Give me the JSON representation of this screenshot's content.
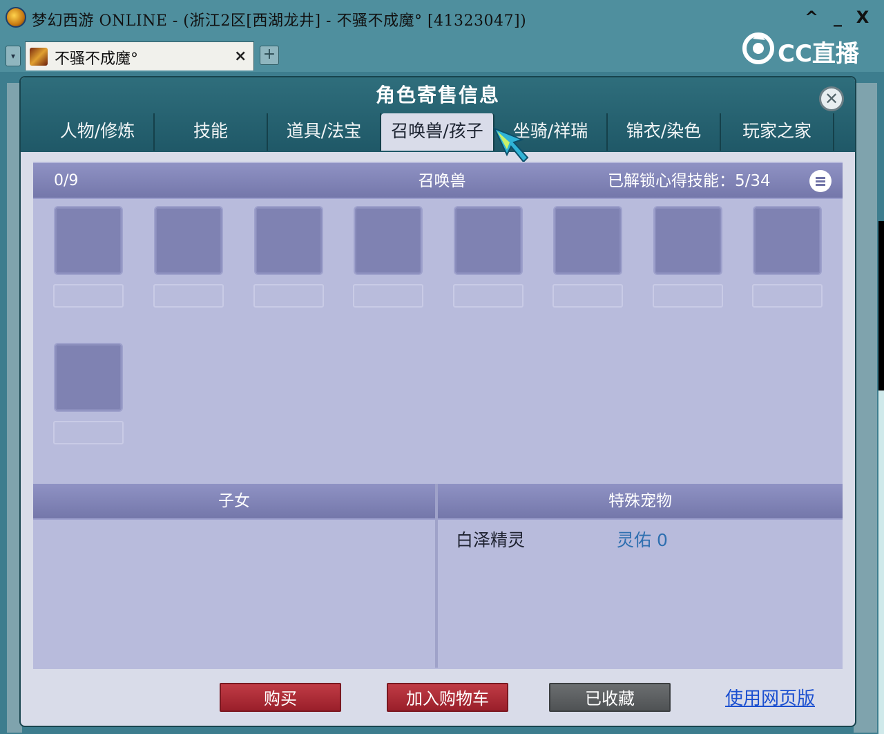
{
  "window": {
    "title": "梦幻西游 ONLINE - (浙江2区[西湖龙井] - 不骚不成魔° [41323047])",
    "controls": [
      "^",
      "_",
      "X"
    ]
  },
  "browser_tab": {
    "title": "不骚不成魔°",
    "close": "×",
    "dropdown": "▾",
    "add": "+"
  },
  "watermark": {
    "text": "CC直播"
  },
  "dialog": {
    "title": "角色寄售信息",
    "close": "✕",
    "tabs": [
      "人物/修炼",
      "技能",
      "道具/法宝",
      "召唤兽/孩子",
      "坐骑/祥瑞",
      "锦衣/染色",
      "玩家之家"
    ],
    "active_tab": "召唤兽/孩子"
  },
  "pets": {
    "count": "0/9",
    "title": "召唤兽",
    "unlocked_skills": "已解锁心得技能：5/34",
    "slot_count": 9
  },
  "children": {
    "title": "子女"
  },
  "special_pets": {
    "title": "特殊宠物",
    "items": [
      {
        "name": "白泽精灵",
        "value": "灵佑 0"
      }
    ]
  },
  "actions": {
    "buy": "购买",
    "add_to_cart": "加入购物车",
    "favorited": "已收藏",
    "web_version": "使用网页版"
  }
}
